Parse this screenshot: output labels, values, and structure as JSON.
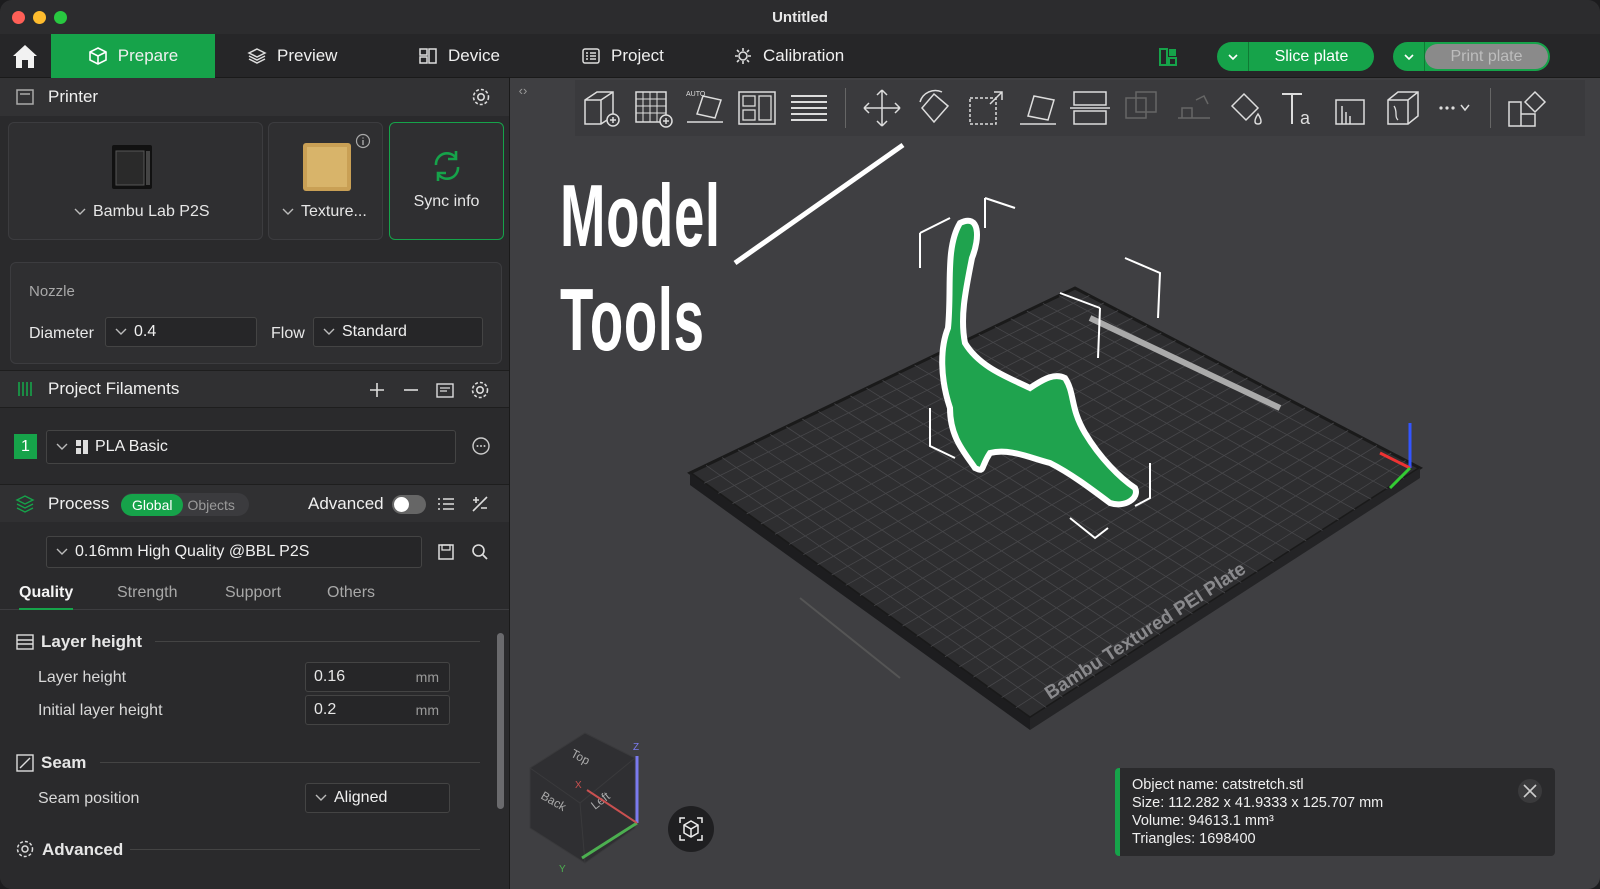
{
  "window": {
    "title": "Untitled"
  },
  "topbar": {
    "tabs": [
      {
        "label": "Prepare",
        "icon": "cube-icon"
      },
      {
        "label": "Preview",
        "icon": "layers-icon"
      },
      {
        "label": "Device",
        "icon": "device-icon"
      },
      {
        "label": "Project",
        "icon": "project-icon"
      },
      {
        "label": "Calibration",
        "icon": "calibration-icon"
      }
    ],
    "slice_label": "Slice plate",
    "print_label": "Print plate"
  },
  "printer": {
    "section_title": "Printer",
    "model": "Bambu Lab P2S",
    "plate": "Texture...",
    "sync_label": "Sync info",
    "nozzle_title": "Nozzle",
    "diameter_label": "Diameter",
    "diameter_value": "0.4",
    "flow_label": "Flow",
    "flow_value": "Standard"
  },
  "filaments": {
    "section_title": "Project Filaments",
    "items": [
      {
        "index": "1",
        "name": "PLA Basic",
        "color": "#16a34a"
      }
    ]
  },
  "process": {
    "section_title": "Process",
    "mode_global": "Global",
    "mode_objects": "Objects",
    "advanced_label": "Advanced",
    "preset": "0.16mm High Quality @BBL P2S",
    "tabs": [
      "Quality",
      "Strength",
      "Support",
      "Others"
    ],
    "active_tab": "Quality",
    "groups": {
      "layer_height": {
        "title": "Layer height",
        "rows": [
          {
            "label": "Layer height",
            "value": "0.16",
            "unit": "mm"
          },
          {
            "label": "Initial layer height",
            "value": "0.2",
            "unit": "mm"
          }
        ]
      },
      "seam": {
        "title": "Seam",
        "position_label": "Seam position",
        "position_value": "Aligned"
      },
      "advanced": {
        "title": "Advanced"
      }
    }
  },
  "viewport": {
    "overlay_line1": "Model",
    "overlay_line2": "Tools",
    "plate_label": "Bambu Textured PEI Plate",
    "cube_faces": {
      "top": "Top",
      "back": "Back",
      "left": "Left"
    },
    "axis_labels": {
      "z": "Z",
      "y": "Y",
      "x": "X"
    },
    "model_color": "#1fa34e",
    "object_info": {
      "name_line": "Object name: catstretch.stl",
      "size_line": "Size: 112.282 x 41.9333 x 125.707 mm",
      "volume_line": "Volume: 94613.1 mm³",
      "triangles_line": "Triangles: 1698400"
    }
  },
  "accent": "#16a34a"
}
